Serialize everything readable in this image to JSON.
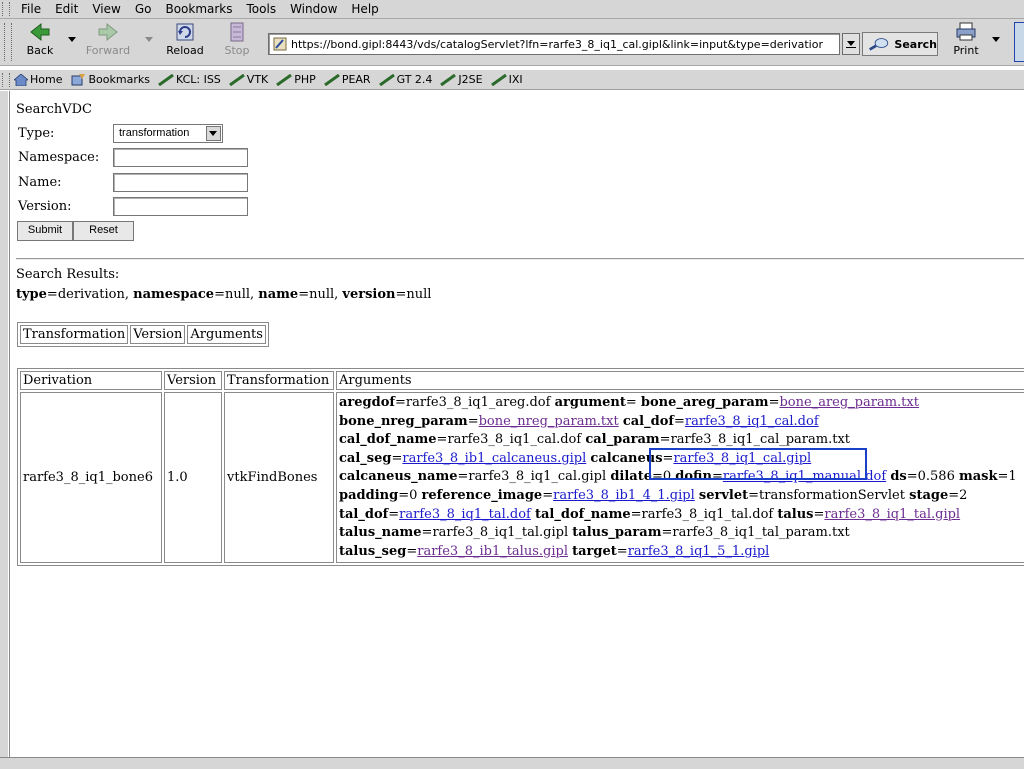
{
  "menu": [
    "File",
    "Edit",
    "View",
    "Go",
    "Bookmarks",
    "Tools",
    "Window",
    "Help"
  ],
  "nav": {
    "back": "Back",
    "forward": "Forward",
    "reload": "Reload",
    "stop": "Stop",
    "url": "https://bond.gipl:8443/vds/catalogServlet?lfn=rarfe3_8_iq1_cal.gipl&link=input&type=derivatior",
    "search": "Search",
    "print": "Print"
  },
  "personal_bar": [
    "Home",
    "Bookmarks",
    "KCL: ISS",
    "VTK",
    "PHP",
    "PEAR",
    "GT 2.4",
    "J2SE",
    "IXI"
  ],
  "form": {
    "title": "SearchVDC",
    "type_label": "Type:",
    "type_value": "transformation",
    "namespace_label": "Namespace:",
    "name_label": "Name:",
    "version_label": "Version:",
    "submit": "Submit",
    "reset": "Reset"
  },
  "results": {
    "label": "Search Results:",
    "type_key": "type",
    "type_val": "=derivation, ",
    "namespace_key": "namespace",
    "namespace_val": "=null, ",
    "name_key": "name",
    "name_val": "=null, ",
    "version_key": "version",
    "version_val": "=null"
  },
  "table1": {
    "headers": [
      "Transformation",
      "Version",
      "Arguments"
    ]
  },
  "table2": {
    "headers": [
      "Derivation",
      "Version",
      "Transformation",
      "Arguments"
    ],
    "row": {
      "derivation": "rarfe3_8_iq1_bone6",
      "version": "1.0",
      "transformation": "vtkFindBones"
    },
    "arguments": [
      [
        {
          "k": "aregdof"
        },
        {
          "t": "=rarfe3_8_iq1_areg.dof "
        },
        {
          "k": "argument"
        },
        {
          "t": "= "
        },
        {
          "k": "bone_areg_param"
        },
        {
          "t": "="
        },
        {
          "v": "bone_areg_param.txt"
        }
      ],
      [
        {
          "k": "bone_nreg_param"
        },
        {
          "t": "="
        },
        {
          "v": "bone_nreg_param.txt"
        },
        {
          "t": " "
        },
        {
          "k": "cal_dof"
        },
        {
          "t": "="
        },
        {
          "l": "rarfe3_8_iq1_cal.dof"
        }
      ],
      [
        {
          "k": "cal_dof_name"
        },
        {
          "t": "=rarfe3_8_iq1_cal.dof "
        },
        {
          "k": "cal_param"
        },
        {
          "t": "=rarfe3_8_iq1_cal_param.txt"
        }
      ],
      [
        {
          "k": "cal_seg"
        },
        {
          "t": "="
        },
        {
          "l": "rarfe3_8_ib1_calcaneus.gipl"
        },
        {
          "t": " "
        },
        {
          "k": "calcaneus"
        },
        {
          "t": "="
        },
        {
          "l": "rarfe3_8_iq1_cal.gipl"
        }
      ],
      [
        {
          "k": "calcaneus_name"
        },
        {
          "t": "=rarfe3_8_iq1_cal.gipl "
        },
        {
          "k": "dilate"
        },
        {
          "t": "=0 "
        },
        {
          "k": "dofin"
        },
        {
          "t": "="
        },
        {
          "l": "rarfe3_8_iq1_manual.dof"
        },
        {
          "t": " "
        },
        {
          "k": "ds"
        },
        {
          "t": "=0.586 "
        },
        {
          "k": "mask"
        },
        {
          "t": "=1"
        }
      ],
      [
        {
          "k": "padding"
        },
        {
          "t": "=0 "
        },
        {
          "k": "reference_image"
        },
        {
          "t": "="
        },
        {
          "l": "rarfe3_8_ib1_4_1.gipl"
        },
        {
          "t": " "
        },
        {
          "k": "servlet"
        },
        {
          "t": "=transformationServlet "
        },
        {
          "k": "stage"
        },
        {
          "t": "=2"
        }
      ],
      [
        {
          "k": "tal_dof"
        },
        {
          "t": "="
        },
        {
          "l": "rarfe3_8_iq1_tal.dof"
        },
        {
          "t": " "
        },
        {
          "k": "tal_dof_name"
        },
        {
          "t": "=rarfe3_8_iq1_tal.dof "
        },
        {
          "k": "talus"
        },
        {
          "t": "="
        },
        {
          "v": "rarfe3_8_iq1_tal.gipl"
        }
      ],
      [
        {
          "k": "talus_name"
        },
        {
          "t": "=rarfe3_8_iq1_tal.gipl "
        },
        {
          "k": "talus_param"
        },
        {
          "t": "=rarfe3_8_iq1_tal_param.txt"
        }
      ],
      [
        {
          "k": "talus_seg"
        },
        {
          "t": "="
        },
        {
          "v": "rarfe3_8_ib1_talus.gipl"
        },
        {
          "t": " "
        },
        {
          "k": "target"
        },
        {
          "t": "="
        },
        {
          "l": "rarfe3_8_iq1_5_1.gipl"
        }
      ]
    ]
  },
  "colors": {
    "link": "#1a1acc",
    "visited": "#6b2c8f",
    "highlight": "#1a3fc8",
    "chrome": "#d6d6d6"
  }
}
